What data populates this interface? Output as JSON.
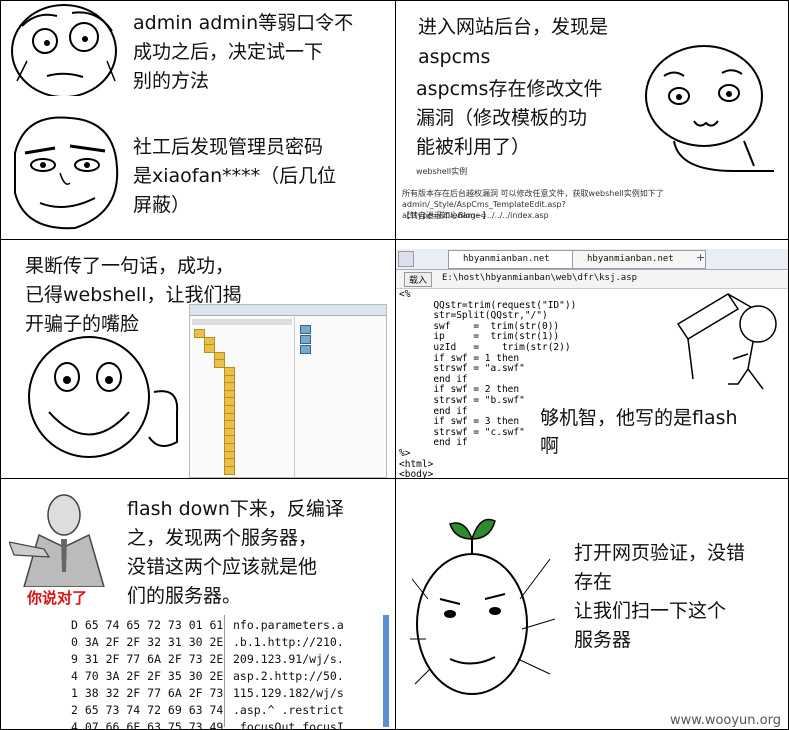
{
  "panels": {
    "p1": {
      "line1": "admin admin等弱口令不",
      "line2": "成功之后，决定试一下",
      "line3": "别的方法",
      "line4": "社工后发现管理员密码",
      "line5": "是xiaofan****（后几位",
      "line6": "屏蔽）"
    },
    "p2": {
      "line1": "进入网站后台，发现是",
      "line2": "aspcms",
      "line3": "aspcms存在修改文件",
      "line4": "漏洞（修改模板的功",
      "line5": "能被利用了）",
      "small1": "所有版本存在后台越权漏洞 可以修改任意文件，获取webshell实例如下了",
      "small2": "admin/_Style/AspCms_TemplateEdit.asp?acttype=&filename=../../../index.asp",
      "small3": "【转自逍遥知心Blog~】",
      "small4": "webshell实例"
    },
    "p3": {
      "line1": "果断传了一句话，成功，",
      "line2": "已得webshell，让我们揭",
      "line3": "开骗子的嘴脸"
    },
    "p4": {
      "tab1": "hbyanmianban.net",
      "tab2": "hbyanmianban.net",
      "tab_plus": "+",
      "load": "载入",
      "path": "E:\\host\\hbyanmianban\\web\\dfr\\ksj.asp",
      "code": "<%\n      QQstr=trim(request(\"ID\"))\n      str=Split(QQstr,\"/\")\n      swf    =  trim(str(0))\n      ip     =  trim(str(1))\n      uzId   =    trim(str(2))\n      if swf = 1 then\n      strswf = \"a.swf\"\n      end if\n      if swf = 2 then\n      strswf = \"b.swf\"\n      end if\n      if swf = 3 then\n      strswf = \"c.swf\"\n      end if\n%>\n<html>\n<body>\n<P align=center>\n<EMBED pluginspage=http://www.macromedia.com/go/getflashplayer src=<%=strswf%>?\ntype=application/x-shockwave-flash wmode=\"transparent\" quality=\"high\">\n</P>\n</body>\n</html>",
      "caption1": "够机智，他写的是flash",
      "caption2": "啊"
    },
    "p5": {
      "line1": "flash down下来，反编译",
      "line2": "之，发现两个服务器，",
      "line3": "没错这两个应该就是他",
      "line4": "们的服务器。",
      "badge": "你说对了",
      "hex_left": "D 65 74 65 72 73 01 61\n0 3A 2F 2F 32 31 30 2E\n9 31 2F 77 6A 2F 73 2E\n4 70 3A 2F 2F 35 30 2E\n1 38 32 2F 77 6A 2F 73\n2 65 73 74 72 69 63 74\n4 07 66 6F 63 75 73 49",
      "hex_right": "nfo.parameters.a\n.b.1.http://210.\n209.123.91/wj/s.\nasp.2.http://50.\n115.129.182/wj/s\n.asp.^ .restrict\n.focusOut.focusI"
    },
    "p6": {
      "line1": "打开网页验证，没错",
      "line2": "存在",
      "line3": "让我们扫一下这个",
      "line4": "服务器"
    }
  },
  "footer": "www.wooyun.org"
}
